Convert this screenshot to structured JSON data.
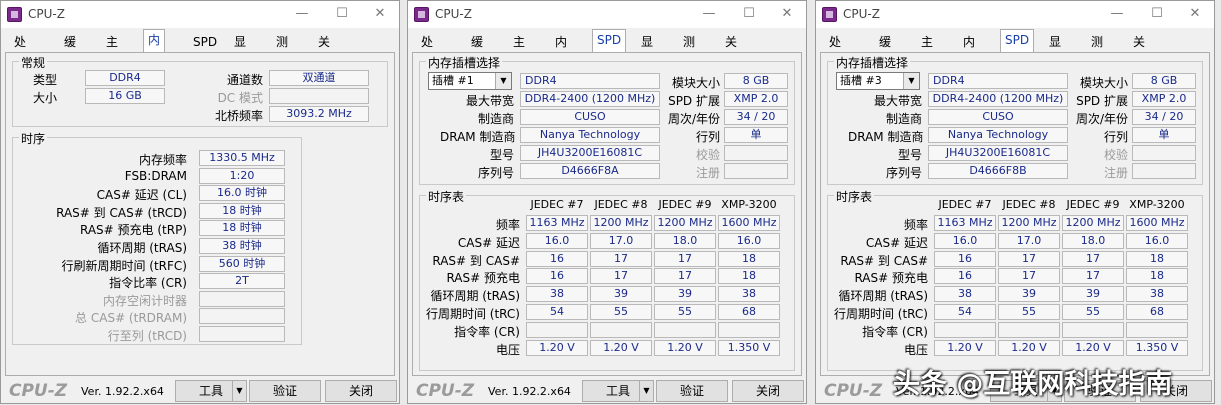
{
  "app_title": "CPU-Z",
  "tabs": [
    "处理器",
    "缓存",
    "主板",
    "内存",
    "SPD",
    "显卡",
    "测试",
    "关于"
  ],
  "memory": {
    "general_title": "常规",
    "type_label": "类型",
    "type_value": "DDR4",
    "size_label": "大小",
    "size_value": "16 GB",
    "channel_label": "通道数",
    "channel_value": "双通道",
    "dc_label": "DC 模式",
    "dc_value": "",
    "nb_label": "北桥频率",
    "nb_value": "3093.2 MHz",
    "timing_title": "时序",
    "rows": [
      {
        "label": "内存频率",
        "value": "1330.5 MHz",
        "disabled": false
      },
      {
        "label": "FSB:DRAM",
        "value": "1:20",
        "disabled": false
      },
      {
        "label": "CAS# 延迟 (CL)",
        "value": "16.0 时钟",
        "disabled": false
      },
      {
        "label": "RAS# 到 CAS# (tRCD)",
        "value": "18 时钟",
        "disabled": false
      },
      {
        "label": "RAS# 预充电 (tRP)",
        "value": "18 时钟",
        "disabled": false
      },
      {
        "label": "循环周期 (tRAS)",
        "value": "38 时钟",
        "disabled": false
      },
      {
        "label": "行刷新周期时间 (tRFC)",
        "value": "560 时钟",
        "disabled": false
      },
      {
        "label": "指令比率 (CR)",
        "value": "2T",
        "disabled": false
      },
      {
        "label": "内存空闲计时器",
        "value": "",
        "disabled": true
      },
      {
        "label": "总 CAS# (tRDRAM)",
        "value": "",
        "disabled": true
      },
      {
        "label": "行至列 (tRCD)",
        "value": "",
        "disabled": true
      }
    ]
  },
  "spd": [
    {
      "group_title": "内存插槽选择",
      "slot": "插槽 #1",
      "type": "DDR4",
      "module_size_label": "模块大小",
      "module_size": "8 GB",
      "max_bw_label": "最大带宽",
      "max_bw": "DDR4-2400 (1200 MHz)",
      "spd_ext_label": "SPD 扩展",
      "spd_ext": "XMP 2.0",
      "mfr_label": "制造商",
      "mfr": "CUSO",
      "week_year_label": "周次/年份",
      "week_year": "34 / 20",
      "dram_mfr_label": "DRAM 制造商",
      "dram_mfr": "Nanya Technology",
      "rank_label": "行列",
      "rank": "单",
      "part_label": "型号",
      "part": "JH4U3200E16081C",
      "check_label": "校验",
      "serial_label": "序列号",
      "serial": "D4666F8A",
      "reg_label": "注册",
      "timing_title": "时序表",
      "columns": [
        "JEDEC #7",
        "JEDEC #8",
        "JEDEC #9",
        "XMP-3200"
      ],
      "rows": [
        {
          "label": "频率",
          "values": [
            "1163 MHz",
            "1200 MHz",
            "1200 MHz",
            "1600 MHz"
          ]
        },
        {
          "label": "CAS# 延迟",
          "values": [
            "16.0",
            "17.0",
            "18.0",
            "16.0"
          ]
        },
        {
          "label": "RAS# 到 CAS#",
          "values": [
            "16",
            "17",
            "17",
            "18"
          ]
        },
        {
          "label": "RAS# 预充电",
          "values": [
            "16",
            "17",
            "17",
            "18"
          ]
        },
        {
          "label": "循环周期 (tRAS)",
          "values": [
            "38",
            "39",
            "39",
            "38"
          ]
        },
        {
          "label": "行周期时间 (tRC)",
          "values": [
            "54",
            "55",
            "55",
            "68"
          ]
        },
        {
          "label": "指令率 (CR)",
          "values": [
            "",
            "",
            "",
            ""
          ]
        },
        {
          "label": "电压",
          "values": [
            "1.20 V",
            "1.20 V",
            "1.20 V",
            "1.350 V"
          ]
        }
      ]
    },
    {
      "group_title": "内存插槽选择",
      "slot": "插槽 #3",
      "type": "DDR4",
      "module_size_label": "模块大小",
      "module_size": "8 GB",
      "max_bw_label": "最大带宽",
      "max_bw": "DDR4-2400 (1200 MHz)",
      "spd_ext_label": "SPD 扩展",
      "spd_ext": "XMP 2.0",
      "mfr_label": "制造商",
      "mfr": "CUSO",
      "week_year_label": "周次/年份",
      "week_year": "34 / 20",
      "dram_mfr_label": "DRAM 制造商",
      "dram_mfr": "Nanya Technology",
      "rank_label": "行列",
      "rank": "单",
      "part_label": "型号",
      "part": "JH4U3200E16081C",
      "check_label": "校验",
      "serial_label": "序列号",
      "serial": "D4666F8B",
      "reg_label": "注册",
      "timing_title": "时序表",
      "columns": [
        "JEDEC #7",
        "JEDEC #8",
        "JEDEC #9",
        "XMP-3200"
      ],
      "rows": [
        {
          "label": "频率",
          "values": [
            "1163 MHz",
            "1200 MHz",
            "1200 MHz",
            "1600 MHz"
          ]
        },
        {
          "label": "CAS# 延迟",
          "values": [
            "16.0",
            "17.0",
            "18.0",
            "16.0"
          ]
        },
        {
          "label": "RAS# 到 CAS#",
          "values": [
            "16",
            "17",
            "17",
            "18"
          ]
        },
        {
          "label": "RAS# 预充电",
          "values": [
            "16",
            "17",
            "17",
            "18"
          ]
        },
        {
          "label": "循环周期 (tRAS)",
          "values": [
            "38",
            "39",
            "39",
            "38"
          ]
        },
        {
          "label": "行周期时间 (tRC)",
          "values": [
            "54",
            "55",
            "55",
            "68"
          ]
        },
        {
          "label": "指令率 (CR)",
          "values": [
            "",
            "",
            "",
            ""
          ]
        },
        {
          "label": "电压",
          "values": [
            "1.20 V",
            "1.20 V",
            "1.20 V",
            "1.350 V"
          ]
        }
      ]
    }
  ],
  "footer": {
    "logo": "CPU-Z",
    "version": "Ver. 1.92.2.x64",
    "tools_label": "工具",
    "validate_label": "验证",
    "close_label": "关闭"
  },
  "watermark": "头条 @互联网科技指南"
}
